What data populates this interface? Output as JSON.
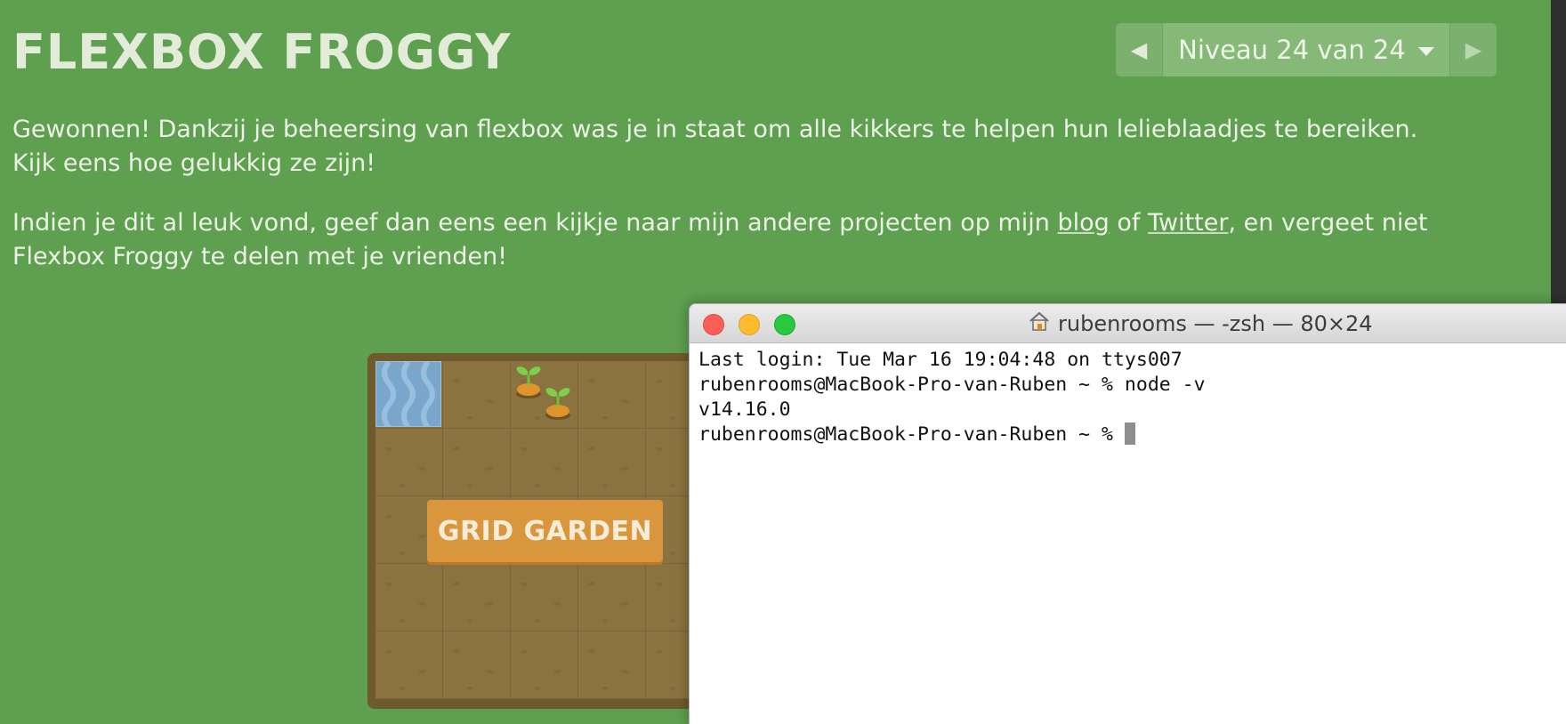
{
  "page": {
    "title": "FLEXBOX FROGGY",
    "paragraph1": "Gewonnen! Dankzij je beheersing van flexbox was je in staat om alle kikkers te helpen hun lelieblaadjes te bereiken. Kijk eens hoe gelukkig ze zijn!",
    "paragraph2_before": "Indien je dit al leuk vond, geef dan eens een kijkje naar mijn andere projecten op mijn ",
    "link_blog": "blog",
    "paragraph2_middle": " of ",
    "link_twitter": "Twitter",
    "paragraph2_after": ", en vergeet niet Flexbox Froggy te delen met je vrienden!"
  },
  "level_nav": {
    "prev_icon": "triangle-left-icon",
    "label": "Niveau 24 van 24",
    "dropdown_icon": "caret-down-icon",
    "next_icon": "triangle-right-icon"
  },
  "garden": {
    "button_label": "GRID GARDEN"
  },
  "terminal": {
    "title": "rubenrooms — -zsh — 80×24",
    "title_icon": "home-icon",
    "lines": [
      "Last login: Tue Mar 16 19:04:48 on ttys007",
      "rubenrooms@MacBook-Pro-van-Ruben ~ % node -v",
      "v14.16.0",
      "rubenrooms@MacBook-Pro-van-Ruben ~ % "
    ]
  },
  "colors": {
    "background": "#5e9f50",
    "title": "#e3ecd8",
    "garden_button": "#d9963d",
    "close": "#fc5f57",
    "minimize": "#fdbc2e",
    "maximize": "#28c840"
  }
}
